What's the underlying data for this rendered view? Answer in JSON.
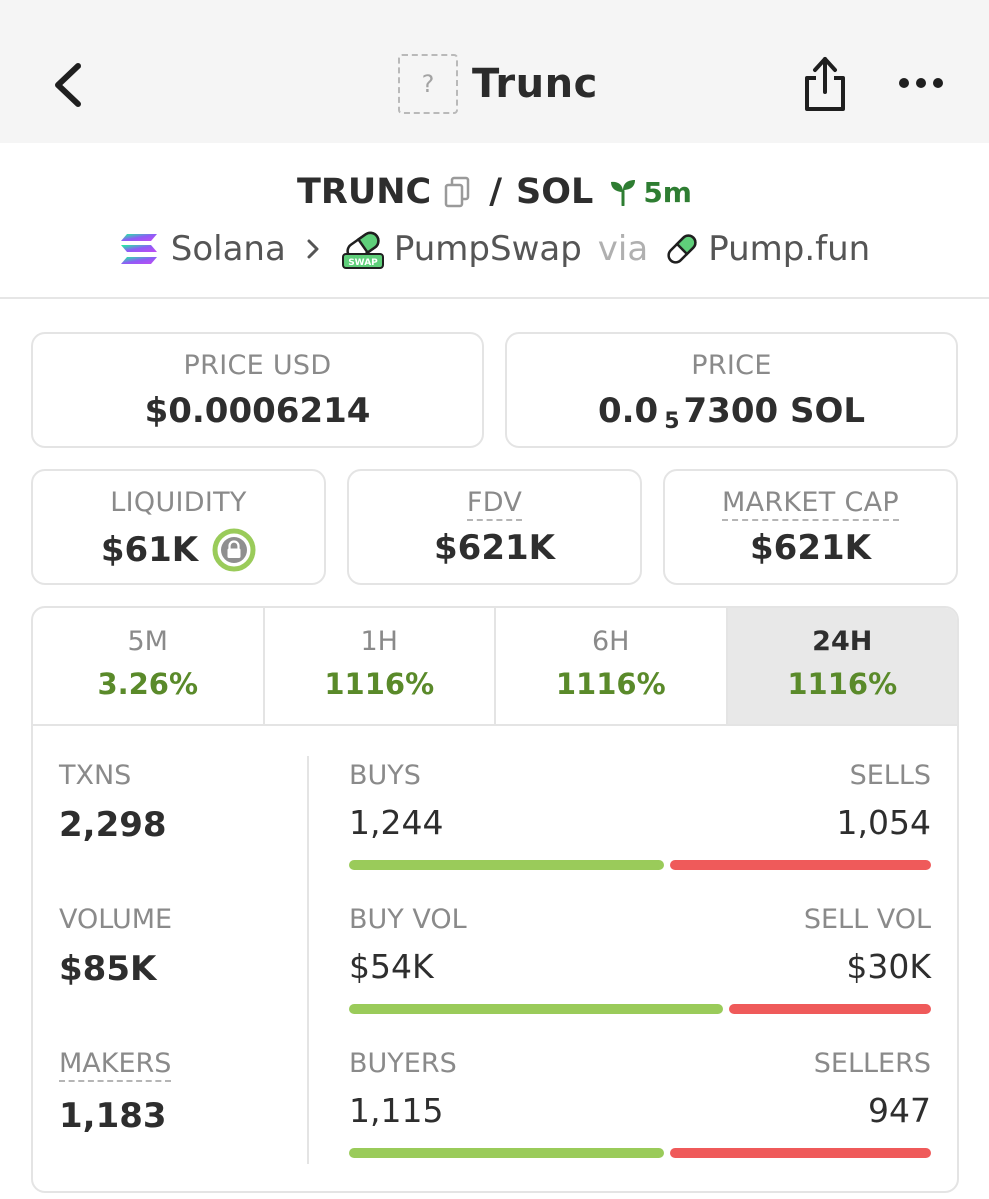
{
  "nav": {
    "title": "Trunc",
    "token_placeholder": "?"
  },
  "pair": {
    "base": "TRUNC",
    "separator": "/",
    "quote": "SOL",
    "age": "5m",
    "chain": "Solana",
    "dex": "PumpSwap",
    "via": "via",
    "launchpad": "Pump.fun"
  },
  "cards": {
    "price_usd": {
      "label": "PRICE USD",
      "value": "$0.0006214"
    },
    "price_native": {
      "label": "PRICE",
      "prefix": "0.0",
      "zeros": "5",
      "suffix": "7300 SOL"
    },
    "liquidity": {
      "label": "LIQUIDITY",
      "value": "$61K"
    },
    "fdv": {
      "label": "FDV",
      "value": "$621K"
    },
    "market_cap": {
      "label": "MARKET CAP",
      "value": "$621K"
    }
  },
  "tabs": [
    {
      "label": "5M",
      "value": "3.26%"
    },
    {
      "label": "1H",
      "value": "1116%"
    },
    {
      "label": "6H",
      "value": "1116%"
    },
    {
      "label": "24H",
      "value": "1116%"
    }
  ],
  "active_tab": "24H",
  "stats": {
    "txns": {
      "label": "TXNS",
      "value": "2,298"
    },
    "volume": {
      "label": "VOLUME",
      "value": "$85K"
    },
    "makers": {
      "label": "MAKERS",
      "value": "1,183"
    }
  },
  "rows": [
    {
      "left_label": "BUYS",
      "left_value": "1,244",
      "right_label": "SELLS",
      "right_value": "1,054",
      "buy_ratio": 0.541
    },
    {
      "left_label": "BUY VOL",
      "left_value": "$54K",
      "right_label": "SELL VOL",
      "right_value": "$30K",
      "buy_ratio": 0.643
    },
    {
      "left_label": "BUYERS",
      "left_value": "1,115",
      "right_label": "SELLERS",
      "right_value": "947",
      "buy_ratio": 0.541
    }
  ],
  "colors": {
    "positive": "#5a8a2a",
    "buy_bar": "#9acb5a",
    "sell_bar": "#ef5a5a",
    "age_badge": "#2e7d32"
  }
}
